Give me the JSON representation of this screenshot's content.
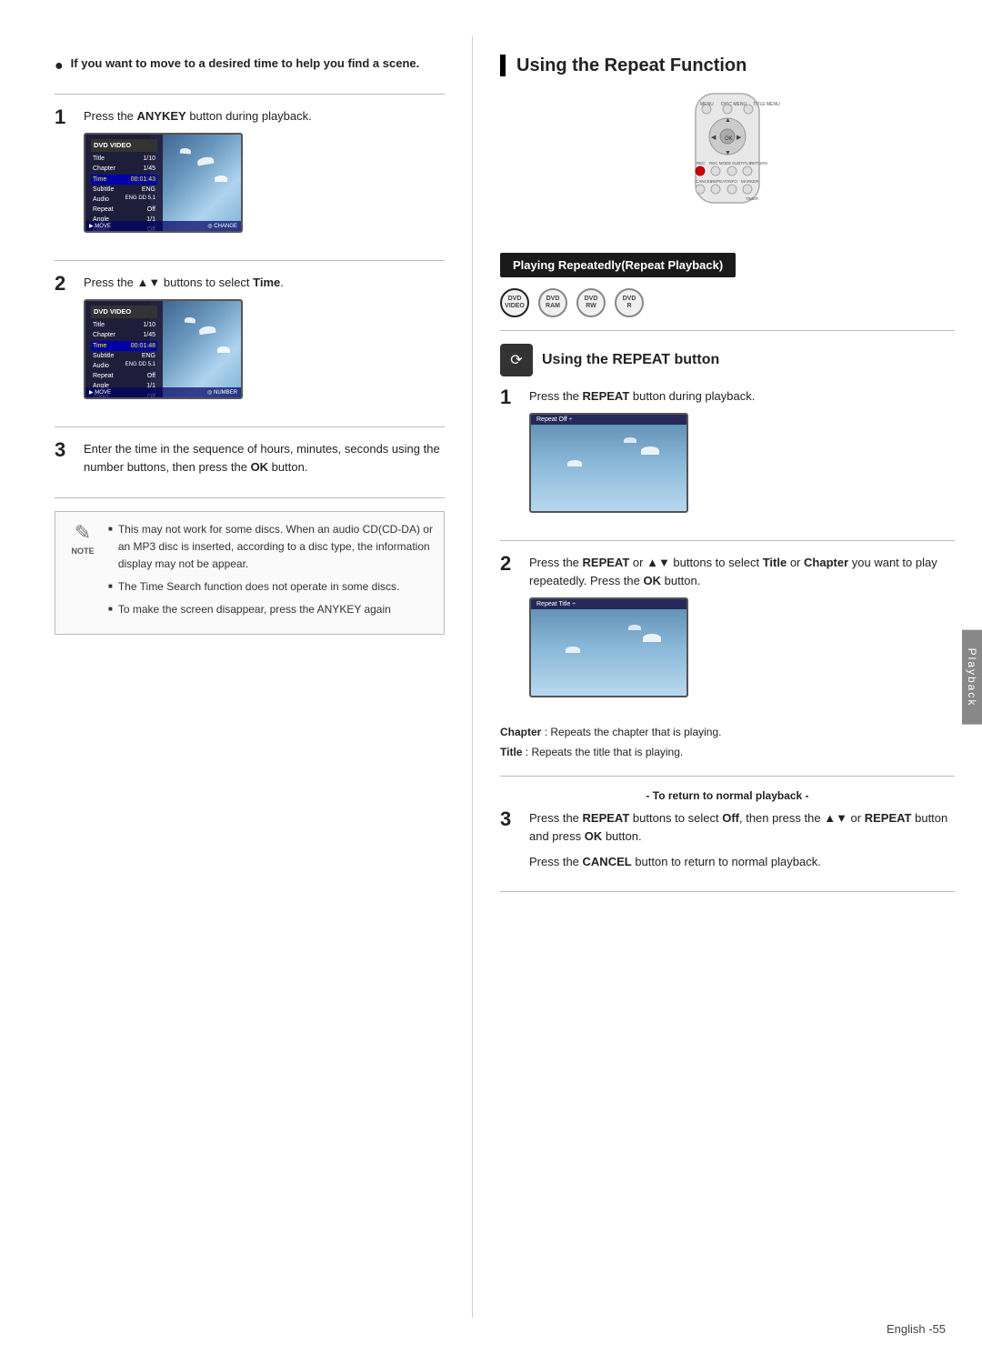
{
  "page": {
    "footer": "English -55",
    "side_tab": "Playback"
  },
  "left": {
    "bullet_intro": "If you want to move to a desired time to help you find a scene.",
    "step1": {
      "num": "1",
      "text_before": "Press the ",
      "bold1": "ANYKEY",
      "text_after": " button during playback."
    },
    "step2": {
      "num": "2",
      "text_before": "Press the ▲▼ buttons to select ",
      "bold1": "Time",
      "text_after": "."
    },
    "step3": {
      "num": "3",
      "text": "Enter the time in the sequence of hours, minutes, seconds using the number buttons, then press the ",
      "bold1": "OK",
      "text2": " button."
    },
    "note": {
      "label": "NOTE",
      "items": [
        "This may not work for some discs. When an audio CD(CD-DA) or an MP3 disc is inserted, according to a disc type, the information display may not be appear.",
        "The Time Search function does not operate in some discs.",
        "To make the screen disappear, press the ANYKEY again"
      ]
    },
    "menu1": {
      "title": "DVD VIDEO",
      "rows": [
        {
          "label": "Title",
          "value": "1/10",
          "selected": false
        },
        {
          "label": "Chapter",
          "value": "1/45",
          "selected": false
        },
        {
          "label": "Time",
          "value": "00:01:43",
          "selected": true
        },
        {
          "label": "Subtitle",
          "value": "ENG",
          "selected": false
        },
        {
          "label": "Audio",
          "value": "ENG DD 5.1CH",
          "selected": false
        },
        {
          "label": "Repeat",
          "value": "Off",
          "selected": false
        },
        {
          "label": "Angle",
          "value": "1/1",
          "selected": false
        },
        {
          "label": "Zoom",
          "value": "Off",
          "selected": false
        }
      ],
      "bottom": "MOVE  CHANGE"
    },
    "menu2": {
      "title": "DVD VIDEO",
      "rows": [
        {
          "label": "Title",
          "value": "1/10",
          "selected": false
        },
        {
          "label": "Chapter",
          "value": "1/45",
          "selected": false
        },
        {
          "label": "Time",
          "value": "00:01:48",
          "selected": true
        },
        {
          "label": "Subtitle",
          "value": "ENG",
          "selected": false
        },
        {
          "label": "Audio",
          "value": "ENG DD 5.1CH",
          "selected": false
        },
        {
          "label": "Repeat",
          "value": "Off",
          "selected": false
        },
        {
          "label": "Angle",
          "value": "1/1",
          "selected": false
        },
        {
          "label": "Zoom",
          "value": "Off",
          "selected": false
        }
      ],
      "bottom": "MOVE  NUMBER"
    }
  },
  "right": {
    "section_title": "Using the Repeat Function",
    "playing_badge": "Playing Repeatedly(Repeat Playback)",
    "disc_icons": [
      {
        "label": "DVD-VIDEO",
        "active": true
      },
      {
        "label": "DVD-RAM",
        "active": false
      },
      {
        "label": "DVD-RW",
        "active": false
      },
      {
        "label": "DVD-R",
        "active": false
      }
    ],
    "subsection_title": "Using the REPEAT button",
    "step1": {
      "num": "1",
      "text_before": "Press the ",
      "bold1": "REPEAT",
      "text_after": " button during playback."
    },
    "repeat_bar1": "Repeat  Off  ÷",
    "step2": {
      "num": "2",
      "text_before": "Press the ",
      "bold1": "REPEAT",
      "text_mid1": " or ▲▼ buttons to select ",
      "bold2": "Title",
      "text_mid2": " or ",
      "bold3": "Chapter",
      "text_after": " you want to play repeatedly. Press the ",
      "bold4": "OK",
      "text_end": " button."
    },
    "repeat_bar2": "Repeat  Title  ÷",
    "chapter_note": "Chapter : Repeats the chapter that is playing.",
    "title_note": "Title : Repeats the title that is playing.",
    "return_label": "- To return to normal playback -",
    "step3": {
      "num": "3",
      "text_before": "Press the ",
      "bold1": "REPEAT",
      "text_mid": " buttons to select ",
      "bold2": "Off",
      "text_mid2": ", then press the ▲▼ or ",
      "bold3": "REPEAT",
      "text_after": " button and press ",
      "bold4": "OK",
      "text_end": " button."
    },
    "step3_note_before": "Press the ",
    "step3_note_bold": "CANCEL",
    "step3_note_after": " button to return to normal playback."
  }
}
